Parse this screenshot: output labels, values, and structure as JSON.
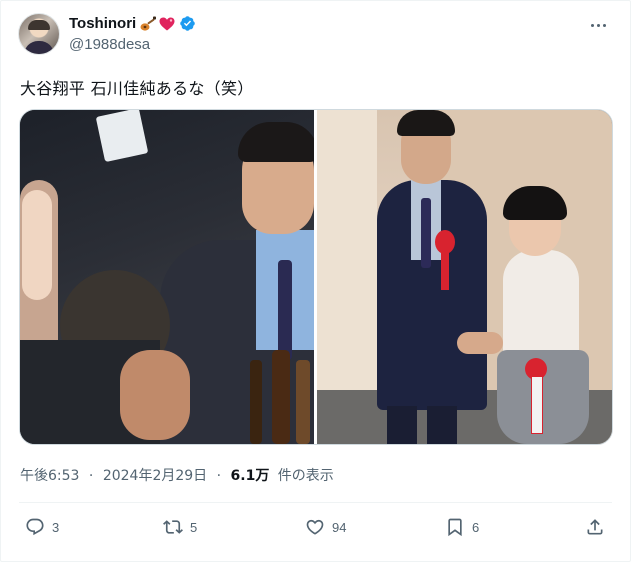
{
  "author": {
    "display_name": "Toshinori",
    "handle": "@1988desa",
    "name_emojis": [
      "guitar-emoji",
      "heart-emoji"
    ],
    "verified_color": "#1d9bf0"
  },
  "tweet": {
    "text": "大谷翔平 石川佳純あるな（笑）",
    "time": "午後6:53",
    "date": "2024年2月29日",
    "separator": "·",
    "views_count": "6.1万",
    "views_label": "件の表示"
  },
  "actions": {
    "replies": "3",
    "retweets": "5",
    "likes": "94",
    "bookmarks": "6"
  },
  "colors": {
    "text": "#0f1419",
    "secondary": "#536471",
    "border": "#cfd9de",
    "accent": "#1d9bf0"
  }
}
